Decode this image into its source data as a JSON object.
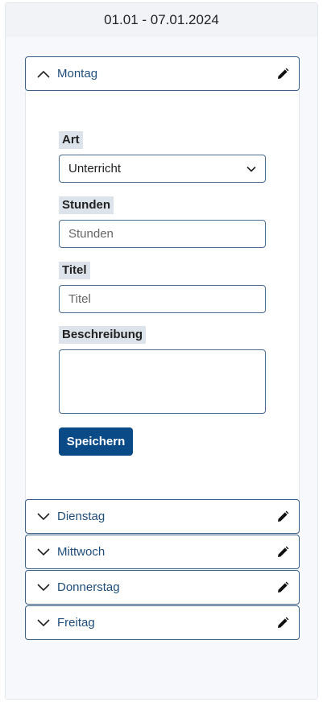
{
  "week": {
    "range": "01.01 - 07.01.2024"
  },
  "days": [
    {
      "label": "Montag",
      "expanded": true
    },
    {
      "label": "Dienstag",
      "expanded": false
    },
    {
      "label": "Mittwoch",
      "expanded": false
    },
    {
      "label": "Donnerstag",
      "expanded": false
    },
    {
      "label": "Freitag",
      "expanded": false
    }
  ],
  "form": {
    "art_label": "Art",
    "art_value": "Unterricht",
    "stunden_label": "Stunden",
    "stunden_placeholder": "Stunden",
    "titel_label": "Titel",
    "titel_placeholder": "Titel",
    "beschreibung_label": "Beschreibung",
    "beschreibung_value": "",
    "save_label": "Speichern"
  },
  "colors": {
    "accent": "#0a4a86",
    "border": "#3a5f85",
    "day_text": "#1f4d7a"
  }
}
